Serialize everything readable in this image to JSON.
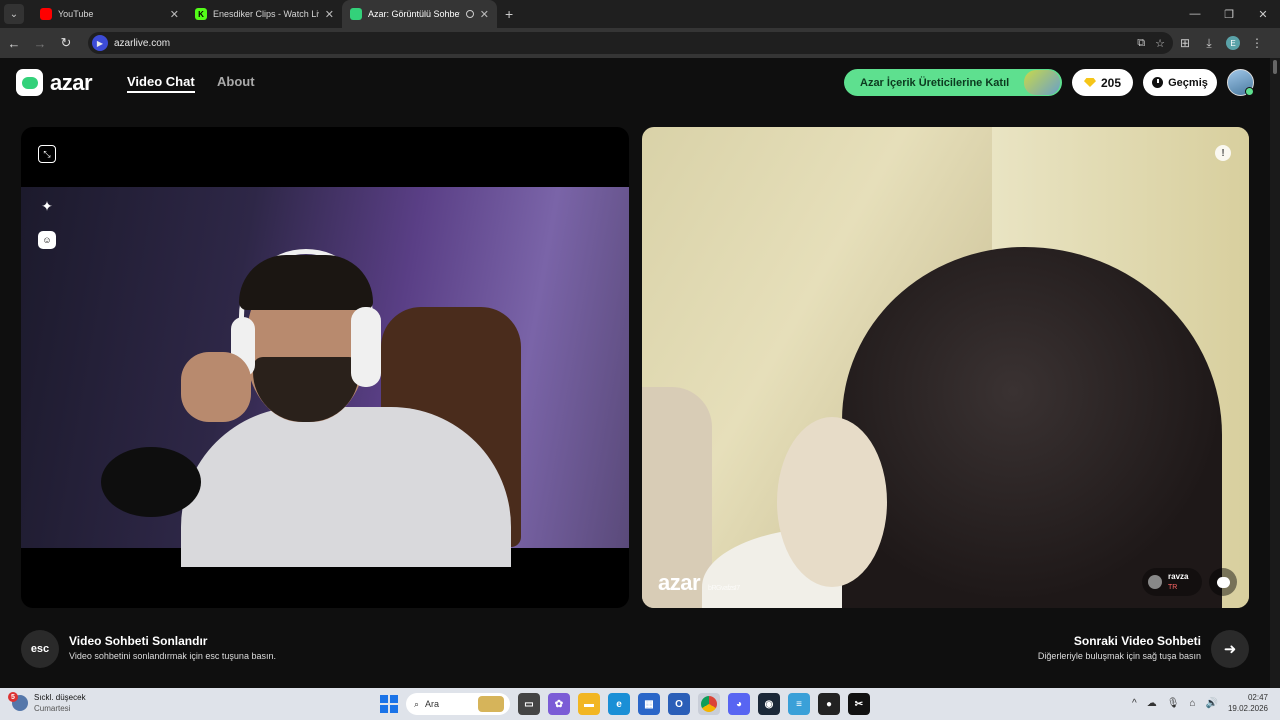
{
  "browser": {
    "tabs": [
      {
        "title": "YouTube",
        "favicon_color": "#ff0000",
        "active": false
      },
      {
        "title": "Enesdiker Clips - Watch Live on",
        "favicon_color": "#53fc18",
        "active": false
      },
      {
        "title": "Azar: Görüntülü Sohbet & Y",
        "favicon_color": "#33d17a",
        "active": true
      }
    ],
    "url": "azarlive.com"
  },
  "header": {
    "logo_text": "azar",
    "nav": {
      "video_chat": "Video Chat",
      "about": "About"
    },
    "creator_cta": "Azar İçerik Üreticilerine Katıl",
    "gems": "205",
    "history": "Geçmiş"
  },
  "remote": {
    "watermark": "azar",
    "watermark_id": "bRGvafzsI7",
    "peer_name": "ravza",
    "peer_country": "TR"
  },
  "controls": {
    "esc_label": "esc",
    "end_title": "Video Sohbeti Sonlandır",
    "end_sub": "Video sohbetini sonlandırmak için esc tuşuna basın.",
    "next_title": "Sonraki Video Sohbeti",
    "next_sub": "Diğerleriyle buluşmak için sağ tuşa basın"
  },
  "taskbar": {
    "weather_badge": "5",
    "weather_title": "Sıckl. düşecek",
    "weather_day": "Cumartesi",
    "search_placeholder": "Ara",
    "time": "02:47",
    "date": "19.02.2026"
  },
  "colors": {
    "accent": "#5ee08f",
    "gem": "#f5c518"
  }
}
